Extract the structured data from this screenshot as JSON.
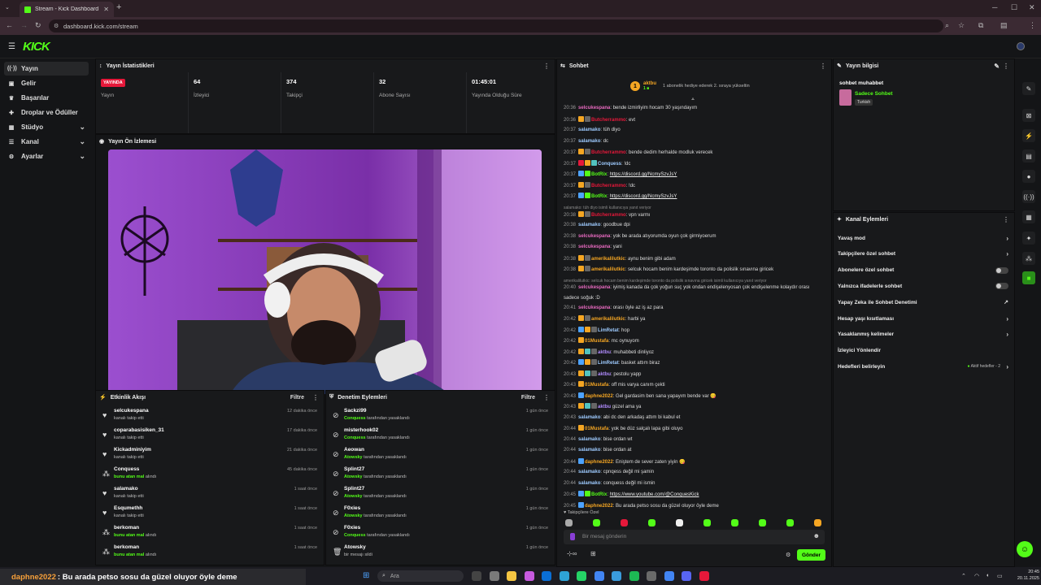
{
  "browser": {
    "tab_title": "Stream - Kick Dashboard",
    "url": "dashboard.kick.com/stream"
  },
  "app": {
    "logo": "KICK"
  },
  "sidebar": {
    "items": [
      {
        "label": "Yayın",
        "icon": "broadcast-icon",
        "active": true
      },
      {
        "label": "Gelir",
        "icon": "wallet-icon"
      },
      {
        "label": "Başarılar",
        "icon": "trophy-icon"
      },
      {
        "label": "Droplar ve Ödüller",
        "icon": "gift-icon"
      },
      {
        "label": "Stüdyo",
        "icon": "studio-icon",
        "expandable": true
      },
      {
        "label": "Kanal",
        "icon": "channel-icon",
        "expandable": true
      },
      {
        "label": "Ayarlar",
        "icon": "gear-icon",
        "expandable": true
      }
    ]
  },
  "stats": {
    "title": "Yayın İstatistikleri",
    "live_badge": "YAYINDA",
    "items": [
      {
        "value": "",
        "label": "Yayın"
      },
      {
        "value": "64",
        "label": "İzleyici"
      },
      {
        "value": "374",
        "label": "Takipçi"
      },
      {
        "value": "32",
        "label": "Abone Sayısı"
      },
      {
        "value": "01:45:01",
        "label": "Yayında Olduğu Süre"
      }
    ]
  },
  "preview": {
    "title": "Yayın Ön İzlemesi"
  },
  "activity": {
    "title": "Etkinlik Akışı",
    "filter": "Filtre",
    "rows": [
      {
        "name": "selcukespana",
        "desc": "kanalı takip etti",
        "time": "12 dakika önce",
        "icon": "heart-icon"
      },
      {
        "name": "coparabasisiken_31",
        "desc": "kanalı takip etti",
        "time": "17 dakika önce",
        "icon": "heart-icon"
      },
      {
        "name": "Kickadminiyim",
        "desc": "kanalı takip etti",
        "time": "21 dakika önce",
        "icon": "heart-icon"
      },
      {
        "name": "Conquess",
        "hl": "bunu atan mal",
        "desc": "alındı",
        "time": "45 dakika önce",
        "icon": "share-icon"
      },
      {
        "name": "salamako",
        "desc": "kanalı takip etti",
        "time": "1 saat önce",
        "icon": "heart-icon"
      },
      {
        "name": "Esqumethh",
        "desc": "kanalı takip etti",
        "time": "1 saat önce",
        "icon": "heart-icon"
      },
      {
        "name": "berkoman",
        "hl": "bunu atan mal",
        "desc": "alındı",
        "time": "1 saat önce",
        "icon": "share-icon"
      },
      {
        "name": "berkoman",
        "hl": "bunu atan mal",
        "desc": "alındı",
        "time": "1 saat önce",
        "icon": "share-icon"
      }
    ]
  },
  "moderation": {
    "title": "Denetim Eylemleri",
    "filter": "Filtre",
    "rows": [
      {
        "name": "Sackzi99",
        "hl": "Conquess",
        "desc": "tarafından yasaklandı",
        "time": "1 gün önce",
        "icon": "ban-icon"
      },
      {
        "name": "misterhook02",
        "hl": "Conquess",
        "desc": "tarafından yasaklandı",
        "time": "1 gün önce",
        "icon": "ban-icon"
      },
      {
        "name": "Aeowan",
        "hl": "Atowsky",
        "desc": "tarafından yasaklandı",
        "time": "1 gün önce",
        "icon": "ban-icon"
      },
      {
        "name": "Splint27",
        "hl": "Atowsky",
        "desc": "tarafından yasaklandı",
        "time": "1 gün önce",
        "icon": "ban-icon"
      },
      {
        "name": "Splint27",
        "hl": "Atowsky",
        "desc": "tarafından yasaklandı",
        "time": "1 gün önce",
        "icon": "ban-icon"
      },
      {
        "name": "F0xies",
        "hl": "Atowsky",
        "desc": "tarafından yasaklandı",
        "time": "1 gün önce",
        "icon": "ban-icon"
      },
      {
        "name": "F0xies",
        "hl": "Conquess",
        "desc": "tarafından yasaklandı",
        "time": "1 gün önce",
        "icon": "ban-icon"
      },
      {
        "name": "Atowsky",
        "hl": "",
        "desc": "bir mesajı sildi",
        "time": "1 gün önce",
        "icon": "trash-icon"
      }
    ]
  },
  "chat": {
    "title": "Sohbet",
    "pinned_user": "aktbu",
    "pinned_count": "1",
    "pinned_text": "1 abonelik hediye ederek 2. sıraya yükseltin",
    "messages": [
      {
        "t": "20:36",
        "u": "selcukespana",
        "c": "#e86ac0",
        "m": ": bende izmirliyim hocam 30 yaşındayım"
      },
      {
        "t": "20:36",
        "u": "Butcherrammo",
        "c": "#e5183a",
        "m": ": evt",
        "b": [
          "#f5a623",
          "#666"
        ]
      },
      {
        "t": "20:37",
        "u": "salamako",
        "c": "#9ecbff",
        "m": ": tüh diyo"
      },
      {
        "t": "20:37",
        "u": "salamako",
        "c": "#9ecbff",
        "m": ": dc"
      },
      {
        "t": "20:37",
        "u": "Butcherrammo",
        "c": "#e5183a",
        "m": ": bende dedim herhalde modluk verecek",
        "b": [
          "#f5a623",
          "#666"
        ]
      },
      {
        "t": "20:37",
        "u": "Conquess",
        "c": "#9ecbff",
        "m": ": !dc",
        "b": [
          "#e5183a",
          "#f5a623",
          "#53c3c0"
        ]
      },
      {
        "t": "20:37",
        "u": "BotRix",
        "c": "#53fc18",
        "m": ": ",
        "link": "https://discord.gg/NcmySzvJsY",
        "b": [
          "#4da3ff",
          "#53fc18"
        ]
      },
      {
        "t": "20:37",
        "u": "Butcherrammo",
        "c": "#e5183a",
        "m": ": !dc",
        "b": [
          "#f5a623",
          "#666"
        ]
      },
      {
        "t": "20:37",
        "u": "BotRix",
        "c": "#53fc18",
        "m": ": ",
        "link": "https://discord.gg/NcmySzvJsY",
        "b": [
          "#4da3ff",
          "#53fc18"
        ]
      },
      {
        "sys": "salamako: tüh diyo isimli kullanıcıya yanıt veriyor"
      },
      {
        "t": "20:38",
        "u": "Butcherrammo",
        "c": "#e5183a",
        "m": ": vpn varmı",
        "b": [
          "#f5a623",
          "#666"
        ]
      },
      {
        "t": "20:38",
        "u": "salamako",
        "c": "#9ecbff",
        "m": ": goodbue dpi"
      },
      {
        "t": "20:38",
        "u": "selcukespana",
        "c": "#e86ac0",
        "m": ": yok be arada atıyorumda oyun çok girmiyoerum"
      },
      {
        "t": "20:38",
        "u": "selcukespana",
        "c": "#e86ac0",
        "m": ": yani"
      },
      {
        "t": "20:38",
        "u": "amerikalilutkic",
        "c": "#f5a623",
        "m": ": aynu benim gibi adam",
        "b": [
          "#f5a623",
          "#666"
        ]
      },
      {
        "t": "20:38",
        "u": "amerikalilutkic",
        "c": "#f5a623",
        "m": ": selcuk hocam benim kardeşimde toronto da polislik sınavına giricek",
        "b": [
          "#f5a623",
          "#666"
        ]
      },
      {
        "sys": "amerikalilutkic: selcuk hocam benim kardeşimde toronto da polislik sınavına giricek isimli kullanıcıya yanıt veriyor"
      },
      {
        "t": "20:40",
        "u": "selcukespana",
        "c": "#e86ac0",
        "m": ": iyimiş kanada da çok yoğun suç yok ondan endişelenyosan çok endişelenme kolaydır orası"
      },
      {
        "cont": "sadece soğuk :D"
      },
      {
        "t": "20:41",
        "u": "selcukespana",
        "c": "#e86ac0",
        "m": ": orası öyle az iş az para"
      },
      {
        "t": "20:42",
        "u": "amerikalilutkic",
        "c": "#f5a623",
        "m": ": harbi ya",
        "b": [
          "#f5a623",
          "#666"
        ]
      },
      {
        "t": "20:42",
        "u": "LimRetat",
        "c": "#9ecbff",
        "m": ": hop",
        "b": [
          "#4da3ff",
          "#f5a623",
          "#666"
        ]
      },
      {
        "t": "20:42",
        "u": "01Mustafa",
        "c": "#f5a623",
        "m": ": mc oynuyom",
        "b": [
          "#f5a623"
        ]
      },
      {
        "t": "20:42",
        "u": "aktbu",
        "c": "#b18cff",
        "m": ": muhabbeti dinliyoz",
        "b": [
          "#f5a623",
          "#53c3c0",
          "#666"
        ]
      },
      {
        "t": "20:42",
        "u": "LimRetat",
        "c": "#9ecbff",
        "m": ": basket attım biraz",
        "b": [
          "#4da3ff",
          "#f5a623",
          "#666"
        ]
      },
      {
        "t": "20:43",
        "u": "aktbu",
        "c": "#b18cff",
        "m": ": pestolu yapp",
        "b": [
          "#f5a623",
          "#53c3c0",
          "#666"
        ]
      },
      {
        "t": "20:43",
        "u": "01Mustafa",
        "c": "#f5a623",
        "m": ": off mis varya canım çekti",
        "b": [
          "#f5a623"
        ]
      },
      {
        "t": "20:43",
        "u": "daphne2022",
        "c": "#f5a623",
        "m": ": Gel gardasim ben sana yapayım bende var 😋",
        "b": [
          "#4da3ff"
        ]
      },
      {
        "t": "20:43",
        "u": "aktbu",
        "c": "#b18cff",
        "m": " güzel ama ya",
        "b": [
          "#f5a623",
          "#53c3c0",
          "#666"
        ]
      },
      {
        "t": "20:43",
        "u": "salamako",
        "c": "#9ecbff",
        "m": ": abi dc den arkadaş attım bi kabul et"
      },
      {
        "t": "20:44",
        "u": "01Mustafa",
        "c": "#f5a623",
        "m": ": yok be düz salçalı lapa gibi oluyo",
        "b": [
          "#f5a623"
        ]
      },
      {
        "t": "20:44",
        "u": "salamako",
        "c": "#9ecbff",
        "m": ": bise ordan wt"
      },
      {
        "t": "20:44",
        "u": "salamako",
        "c": "#9ecbff",
        "m": ": bise ordan at"
      },
      {
        "t": "20:44",
        "u": "daphne2022",
        "c": "#f5a623",
        "m": ": Eniştem de sever zaten yiyin 😋",
        "b": [
          "#4da3ff"
        ]
      },
      {
        "t": "20:44",
        "u": "salamako",
        "c": "#9ecbff",
        "m": ": cpnqess değil mi şamin"
      },
      {
        "t": "20:44",
        "u": "salamako",
        "c": "#9ecbff",
        "m": ": conquess değil mi ismin"
      },
      {
        "t": "20:45",
        "u": "BotRix",
        "c": "#53fc18",
        "m": ": ",
        "link": "https://www.youtube.com/@ConquesKick",
        "b": [
          "#4da3ff",
          "#53fc18"
        ]
      },
      {
        "t": "20:45",
        "u": "daphne2022",
        "c": "#f5a623",
        "m": ": Bu arada petso sosu da güzel oluyor öyle deme",
        "b": [
          "#4da3ff"
        ]
      }
    ],
    "followers_only": "Takipçilere Özel",
    "input_placeholder": "Bir mesaj gönderin",
    "send": "Gönder"
  },
  "stream_info": {
    "title": "Yayın bilgisi",
    "stream_title": "sohbet muhabbet",
    "category": "Sadece Sohbet",
    "language": "Turkish"
  },
  "channel_actions": {
    "title": "Kanal Eylemleri",
    "rows": [
      {
        "label": "Yavaş mod",
        "kind": "chevron"
      },
      {
        "label": "Takipçilere özel sohbet",
        "kind": "chevron"
      },
      {
        "label": "Abonelere özel sohbet",
        "kind": "toggle"
      },
      {
        "label": "Yalnızca ifadelerle sohbet",
        "kind": "toggle"
      },
      {
        "label": "Yapay Zeka ile Sohbet Denetimi",
        "kind": "external"
      },
      {
        "label": "Hesap yaşı kısıtlaması",
        "kind": "chevron"
      },
      {
        "label": "Yasaklanmış kelimeler",
        "kind": "chevron"
      },
      {
        "label": "İzleyici Yönlendir",
        "kind": "none"
      },
      {
        "label": "Hedefleri belirleyin",
        "kind": "goal",
        "extra": "Aktif hedefler - 2"
      }
    ]
  },
  "overlay": {
    "banner_user": "daphne2022",
    "banner_text": ": Bu arada petso sosu da güzel oluyor öyle deme"
  },
  "taskbar": {
    "search": "Ara",
    "time": "20:45",
    "date": "20.11.2025"
  }
}
